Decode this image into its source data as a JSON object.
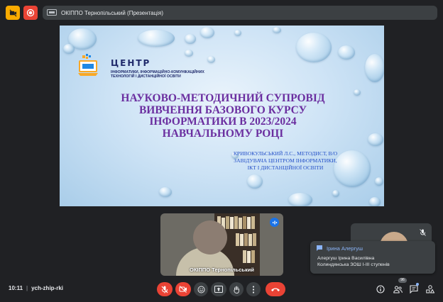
{
  "top": {
    "presenting_label": "ОКІППО Тернопільський (Презентація)"
  },
  "slide": {
    "logo_title": "ЦЕНТР",
    "logo_subtitle_lines": [
      "ІНФОРМАТИКИ, ІНФОРМАЦІЙНО-КОМУНІКАЦІЙНИХ",
      "ТЕХНОЛОГІЙ І ДИСТАНЦІЙНОЇ ОСВІТИ"
    ],
    "title_lines": [
      "НАУКОВО-МЕТОДИЧНИЙ СУПРОВІД",
      "ВИВЧЕННЯ БАЗОВОГО КУРСУ",
      "ІНФОРМАТИКИ В 2023/2024",
      "НАВЧАЛЬНОМУ РОЦІ"
    ],
    "author_lines": [
      "КРИВОКУЛЬСЬКИЙ Л.С., МЕТОДИСТ, В/О",
      "ЗАВІДУВАЧА ЦЕНТРОМ ІНФОРМАТИКИ,",
      "ІКТ І ДИСТАНЦІЙНОЇ ОСВІТИ"
    ]
  },
  "participant_tile": {
    "name": "ОКІППО Тернопільський"
  },
  "chat_toast": {
    "sender": "Ірина Алергуш",
    "line1": "Алергуш Ірина Василівна",
    "line2": "Колиндянська ЗОШ І-ІІІ ступенів"
  },
  "bottom": {
    "time": "10:11",
    "separator": "|",
    "meeting_code": "ych-zhip-rki",
    "participants_count": "96"
  },
  "colors": {
    "background": "#202124",
    "control_red": "#ea4335",
    "control_grey": "#3c4043",
    "accent_blue": "#1a73e8",
    "camera_warning": "#f9ab00",
    "slide_title": "#6b2fa0",
    "slide_author": "#2450c8"
  },
  "icons": [
    "camera-off-icon",
    "record-icon",
    "presentation-icon",
    "speaking-icon",
    "mic-off-icon",
    "chat-icon",
    "emoji-icon",
    "present-icon",
    "raise-hand-icon",
    "more-icon",
    "hang-up-icon",
    "info-icon",
    "people-icon",
    "activities-icon"
  ]
}
